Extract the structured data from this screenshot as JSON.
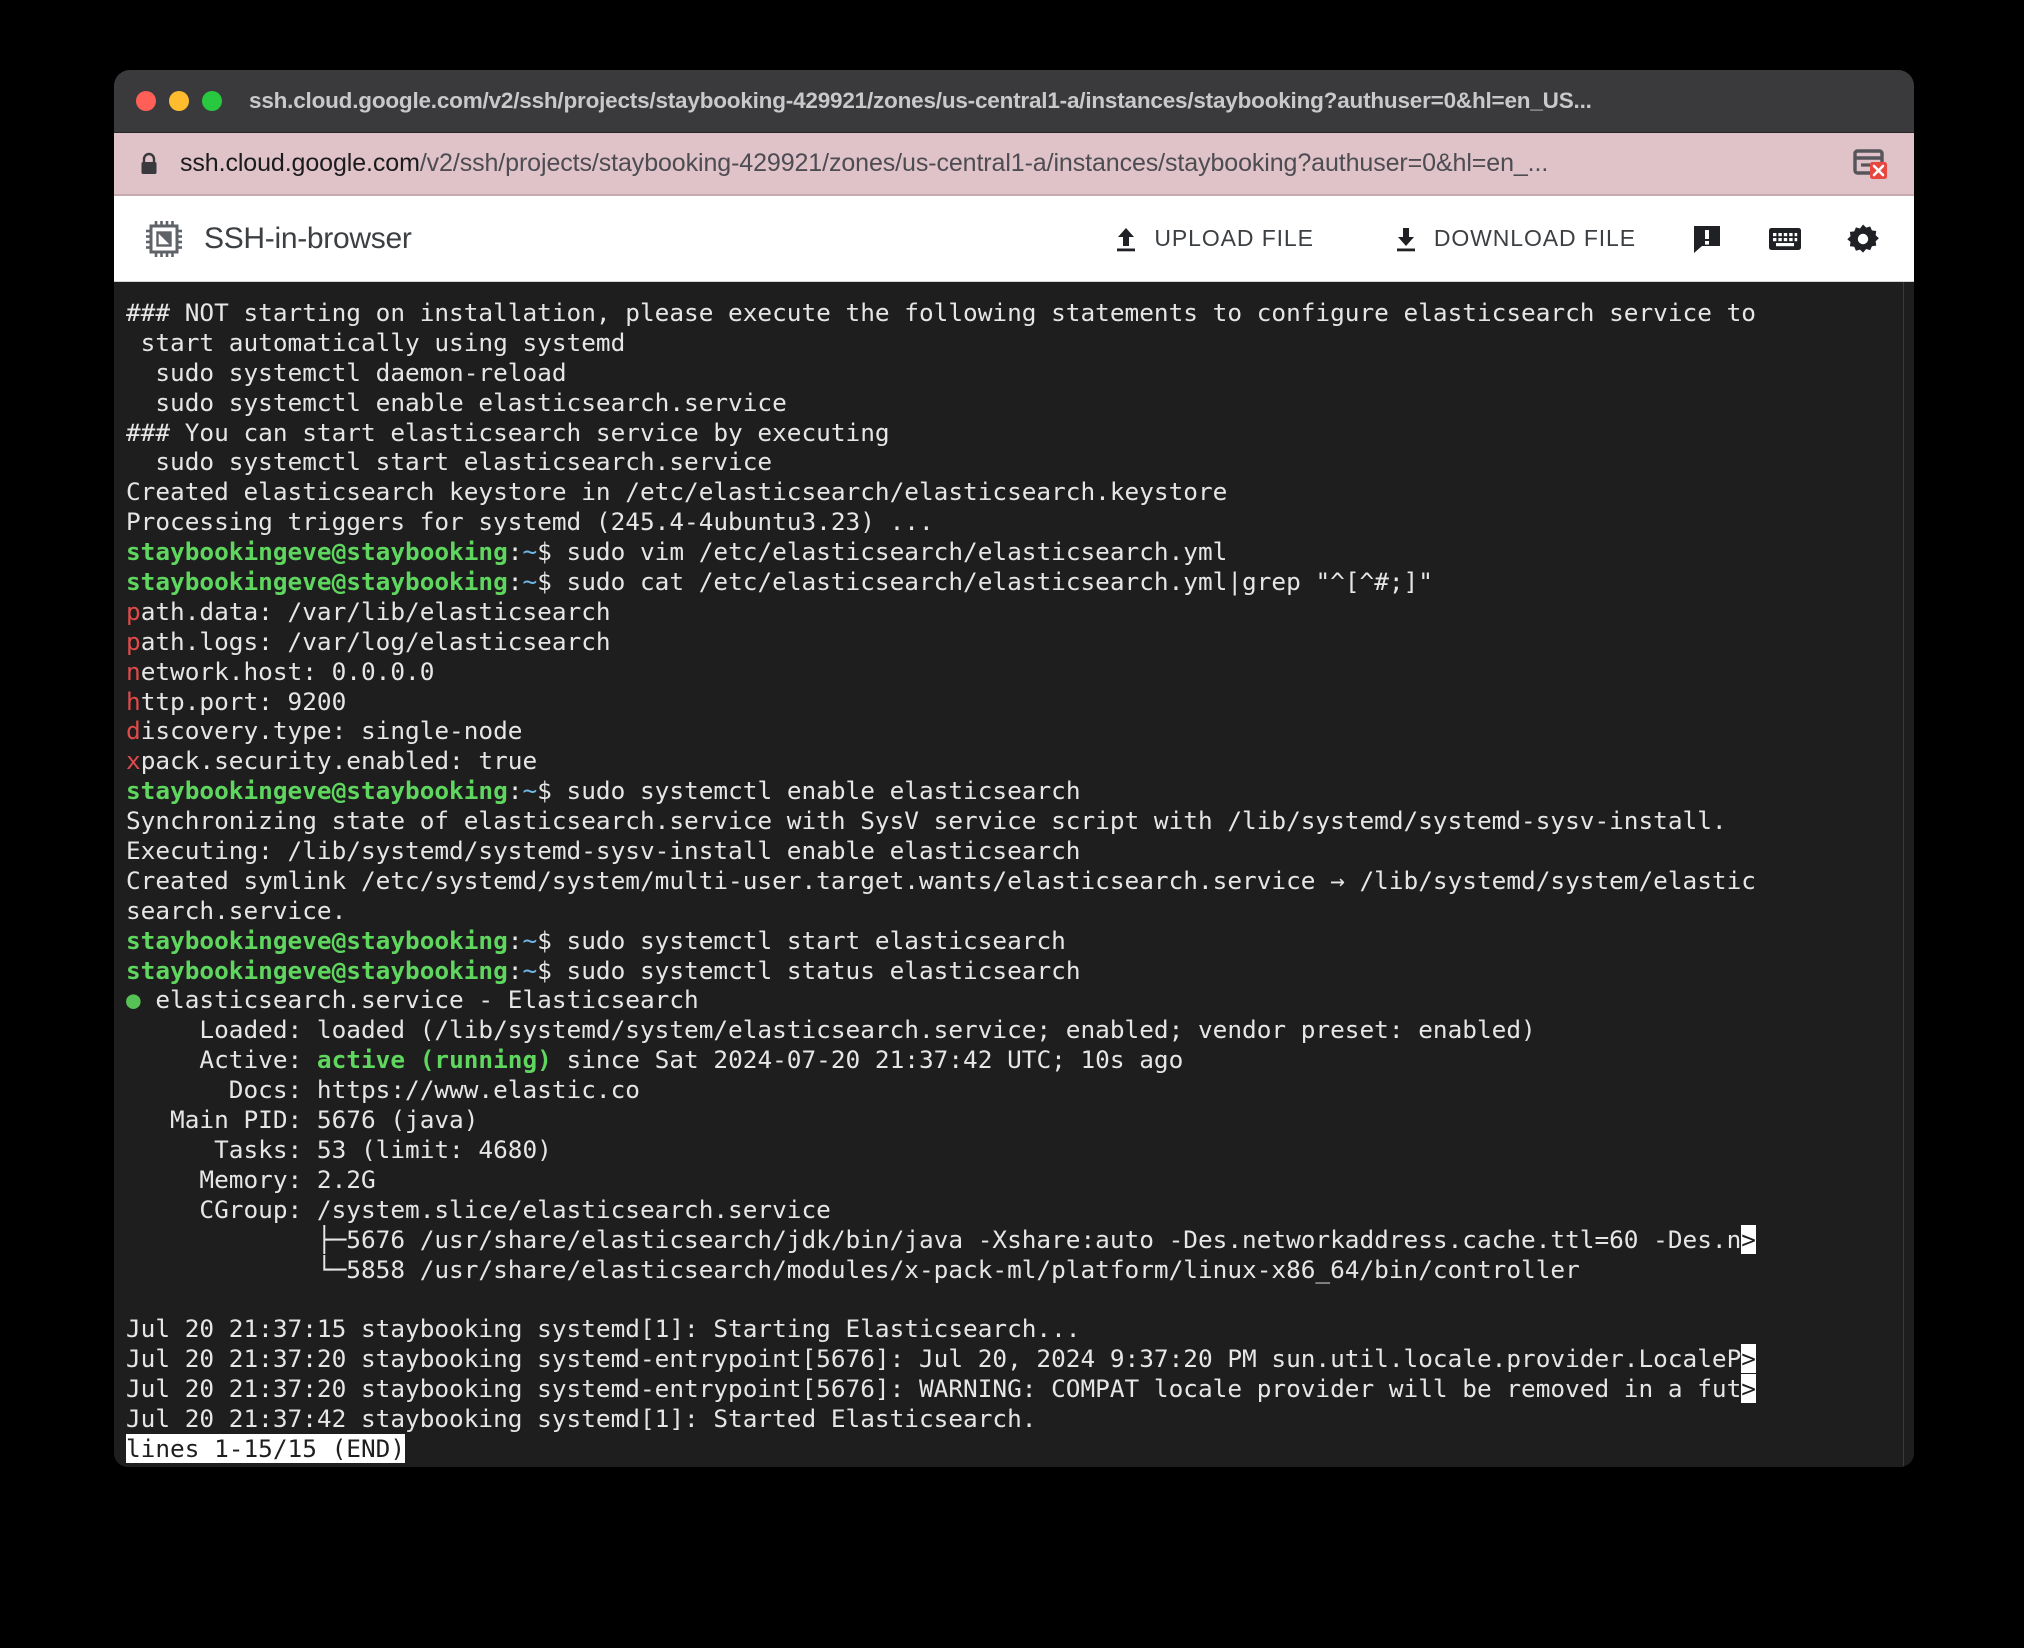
{
  "window": {
    "title": "ssh.cloud.google.com/v2/ssh/projects/staybooking-429921/zones/us-central1-a/instances/staybooking?authuser=0&hl=en_US...",
    "traffic_lights": [
      "close",
      "minimize",
      "maximize"
    ]
  },
  "urlbar": {
    "lock_icon": "lock-icon",
    "host": "ssh.cloud.google.com",
    "path": "/v2/ssh/projects/staybooking-429921/zones/us-central1-a/instances/staybooking?authuser=0&hl=en_...",
    "popup_icon": "popup-blocked-icon"
  },
  "app_header": {
    "brand_icon": "chip-icon",
    "title": "SSH-in-browser",
    "upload_label": "UPLOAD FILE",
    "download_label": "DOWNLOAD FILE",
    "icons": [
      "feedback-icon",
      "keyboard-icon",
      "gear-icon"
    ]
  },
  "terminal": {
    "prompt_user": "staybookingeve@staybooking",
    "prompt_sep": ":",
    "prompt_tilde": "~",
    "prompt_dollar": "$ ",
    "status_line": "lines 1-15/15 (END)",
    "lines": [
      {
        "id": "l01",
        "text": "### NOT starting on installation, please execute the following statements to configure elasticsearch service to"
      },
      {
        "id": "l02",
        "text": " start automatically using systemd"
      },
      {
        "id": "l03",
        "text": "  sudo systemctl daemon-reload"
      },
      {
        "id": "l04",
        "text": "  sudo systemctl enable elasticsearch.service"
      },
      {
        "id": "l05",
        "text": "### You can start elasticsearch service by executing"
      },
      {
        "id": "l06",
        "text": "  sudo systemctl start elasticsearch.service"
      },
      {
        "id": "l07",
        "text": "Created elasticsearch keystore in /etc/elasticsearch/elasticsearch.keystore"
      },
      {
        "id": "l08",
        "text": "Processing triggers for systemd (245.4-4ubuntu3.23) ..."
      },
      {
        "id": "l09",
        "type": "prompt",
        "command": "sudo vim /etc/elasticsearch/elasticsearch.yml"
      },
      {
        "id": "l10",
        "type": "prompt",
        "command": "sudo cat /etc/elasticsearch/elasticsearch.yml|grep \"^[^#;]\""
      },
      {
        "id": "l11",
        "type": "grep",
        "head": "p",
        "rest": "ath.data: /var/lib/elasticsearch"
      },
      {
        "id": "l12",
        "type": "grep",
        "head": "p",
        "rest": "ath.logs: /var/log/elasticsearch"
      },
      {
        "id": "l13",
        "type": "grep",
        "head": "n",
        "rest": "etwork.host: 0.0.0.0"
      },
      {
        "id": "l14",
        "type": "grep",
        "head": "h",
        "rest": "ttp.port: 9200"
      },
      {
        "id": "l15",
        "type": "grep",
        "head": "d",
        "rest": "iscovery.type: single-node"
      },
      {
        "id": "l16",
        "type": "grep",
        "head": "x",
        "rest": "pack.security.enabled: true"
      },
      {
        "id": "l17",
        "type": "prompt",
        "command": "sudo systemctl enable elasticsearch"
      },
      {
        "id": "l18",
        "text": "Synchronizing state of elasticsearch.service with SysV service script with /lib/systemd/systemd-sysv-install."
      },
      {
        "id": "l19",
        "text": "Executing: /lib/systemd/systemd-sysv-install enable elasticsearch"
      },
      {
        "id": "l20",
        "text": "Created symlink /etc/systemd/system/multi-user.target.wants/elasticsearch.service → /lib/systemd/system/elastic"
      },
      {
        "id": "l21",
        "text": "search.service."
      },
      {
        "id": "l22",
        "type": "prompt",
        "command": "sudo systemctl start elasticsearch"
      },
      {
        "id": "l23",
        "type": "prompt",
        "command": "sudo systemctl status elasticsearch"
      },
      {
        "id": "l24",
        "type": "bullet",
        "bullet": "●",
        "text": " elasticsearch.service - Elasticsearch"
      },
      {
        "id": "l25",
        "text": "     Loaded: loaded (/lib/systemd/system/elasticsearch.service; enabled; vendor preset: enabled)"
      },
      {
        "id": "l26",
        "type": "active",
        "prefix": "     Active: ",
        "state": "active (running)",
        "suffix": " since Sat 2024-07-20 21:37:42 UTC; 10s ago"
      },
      {
        "id": "l27",
        "text": "       Docs: https://www.elastic.co"
      },
      {
        "id": "l28",
        "text": "   Main PID: 5676 (java)"
      },
      {
        "id": "l29",
        "text": "      Tasks: 53 (limit: 4680)"
      },
      {
        "id": "l30",
        "text": "     Memory: 2.2G"
      },
      {
        "id": "l31",
        "text": "     CGroup: /system.slice/elasticsearch.service"
      },
      {
        "id": "l32",
        "type": "trunc",
        "text": "             ├─5676 /usr/share/elasticsearch/jdk/bin/java -Xshare:auto -Des.networkaddress.cache.ttl=60 -Des.n",
        "marker": ">"
      },
      {
        "id": "l33",
        "text": "             └─5858 /usr/share/elasticsearch/modules/x-pack-ml/platform/linux-x86_64/bin/controller"
      },
      {
        "id": "l34",
        "text": ""
      },
      {
        "id": "l35",
        "text": "Jul 20 21:37:15 staybooking systemd[1]: Starting Elasticsearch..."
      },
      {
        "id": "l36",
        "type": "trunc",
        "text": "Jul 20 21:37:20 staybooking systemd-entrypoint[5676]: Jul 20, 2024 9:37:20 PM sun.util.locale.provider.LocaleP",
        "marker": ">"
      },
      {
        "id": "l37",
        "type": "trunc",
        "text": "Jul 20 21:37:20 staybooking systemd-entrypoint[5676]: WARNING: COMPAT locale provider will be removed in a fut",
        "marker": ">"
      },
      {
        "id": "l38",
        "text": "Jul 20 21:37:42 staybooking systemd[1]: Started Elasticsearch."
      }
    ]
  },
  "colors": {
    "prompt_green": "#5fd75f",
    "tilde_blue": "#6fb7e8",
    "grep_red": "#e04a4a",
    "active_green": "#5fd75f",
    "terminal_bg": "#1e1e1e",
    "urlbar_bg": "#dfc3c9",
    "titlebar_bg": "#3a3a3c"
  }
}
